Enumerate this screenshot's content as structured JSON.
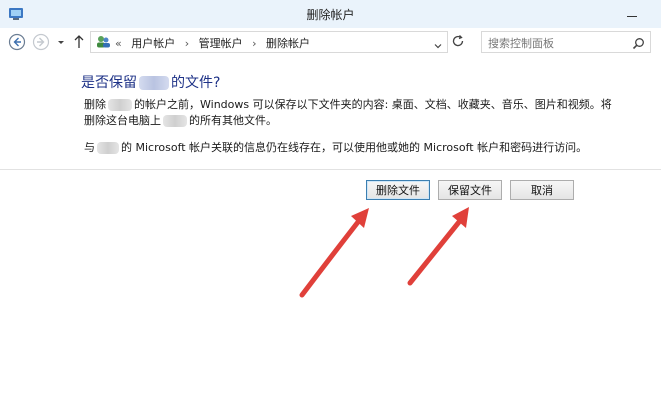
{
  "window": {
    "title": "删除帐户"
  },
  "nav": {
    "breadcrumb_prefix": "«",
    "breadcrumbs": [
      "用户帐户",
      "管理帐户",
      "删除帐户"
    ],
    "search_placeholder": "搜索控制面板"
  },
  "content": {
    "heading_pre": "是否保留",
    "heading_post": "的文件?",
    "para1_pre": "删除",
    "para1_post": "的帐户之前，Windows 可以保存以下文件夹的内容: 桌面、文档、收藏夹、音乐、图片和视频。将",
    "para2_pre": "删除这台电脑上",
    "para2_post": "的所有其他文件。",
    "para3_pre": "与",
    "para3_post": "的 Microsoft 帐户关联的信息仍在线存在，可以使用他或她的 Microsoft 帐户和密码进行访问。"
  },
  "buttons": {
    "delete_files": "删除文件",
    "keep_files": "保留文件",
    "cancel": "取消"
  },
  "colors": {
    "heading": "#1e3287",
    "arrow": "#e0403a",
    "titlebar": "#eaf3fb"
  }
}
